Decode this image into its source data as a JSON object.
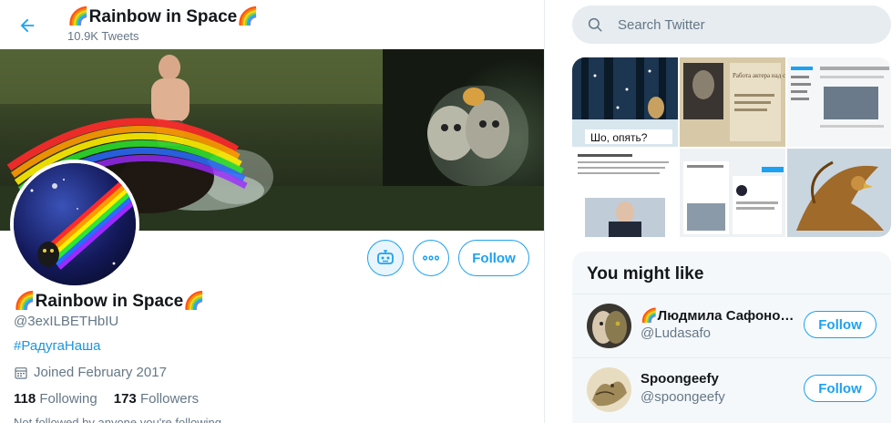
{
  "header": {
    "title": "🌈Rainbow in Space🌈",
    "tweet_count": "10.9K Tweets"
  },
  "banner": {
    "caption": ""
  },
  "profile": {
    "name": "🌈Rainbow in Space🌈",
    "handle": "@3exILBETHbIU",
    "hashtag": "#РадугаНаша",
    "joined": "Joined February 2017",
    "following_count": "118",
    "following_label": "Following",
    "followers_count": "173",
    "followers_label": "Followers",
    "truncated_line": "Not followed by anyone you're following"
  },
  "actions": {
    "follow_label": "Follow"
  },
  "sidebar": {
    "search_placeholder": "Search Twitter",
    "media_tiles": [
      {
        "caption": "Шо, опять?"
      },
      {
        "caption": "Работа актера над собой"
      },
      {
        "caption": ""
      },
      {
        "caption": ""
      },
      {
        "caption": ""
      },
      {
        "caption": ""
      }
    ],
    "you_might_like": {
      "title": "You might like",
      "users": [
        {
          "name": "🌈Людмила Сафоно…",
          "handle": "@Ludasafo",
          "follow_label": "Follow"
        },
        {
          "name": "Spoongeefy",
          "handle": "@spoongeefy",
          "follow_label": "Follow"
        }
      ]
    }
  },
  "colors": {
    "accent": "#1da1f2",
    "secondary_text": "#657786",
    "search_bg": "#e6ecf0",
    "panel_bg": "#f5f8fa"
  }
}
